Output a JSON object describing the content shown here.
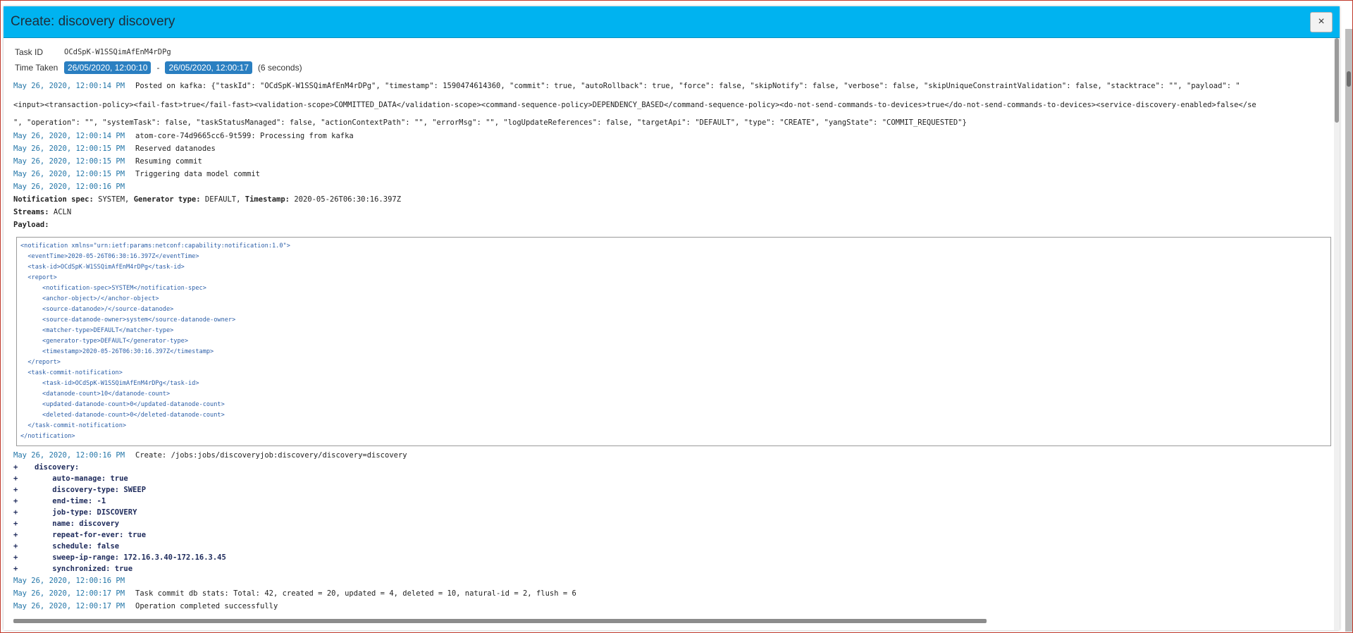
{
  "modal": {
    "title": "Create: discovery discovery",
    "close_label": "×"
  },
  "task": {
    "id_label": "Task ID",
    "id_value": "OCdSpK-W1SSQimAfEnM4rDPg",
    "time_label": "Time Taken",
    "start": "26/05/2020, 12:00:10",
    "separator": "-",
    "end": "26/05/2020, 12:00:17",
    "duration": "(6 seconds)"
  },
  "log": {
    "kafka_ts": "May 26, 2020, 12:00:14 PM",
    "kafka_msg_1": "Posted on kafka: {\"taskId\": \"OCdSpK-W1SSQimAfEnM4rDPg\", \"timestamp\": 1590474614360, \"commit\": true, \"autoRollback\": true, \"force\": false, \"skipNotify\": false, \"verbose\": false, \"skipUniqueConstraintValidation\": false, \"stacktrace\": \"\", \"payload\": \"",
    "kafka_msg_2": "<input><transaction-policy><fail-fast>true</fail-fast><validation-scope>COMMITTED_DATA</validation-scope><command-sequence-policy>DEPENDENCY_BASED</command-sequence-policy><do-not-send-commands-to-devices>true</do-not-send-commands-to-devices><service-discovery-enabled>false</se",
    "kafka_msg_3": "\", \"operation\": \"\", \"systemTask\": false, \"taskStatusManaged\": false, \"actionContextPath\": \"\", \"errorMsg\": \"\", \"logUpdateReferences\": false, \"targetApi\": \"DEFAULT\", \"type\": \"CREATE\", \"yangState\": \"COMMIT_REQUESTED\"}",
    "entries_a": [
      {
        "ts": "May 26, 2020, 12:00:14 PM",
        "msg": "atom-core-74d9665cc6-9t599: Processing from kafka"
      },
      {
        "ts": "May 26, 2020, 12:00:15 PM",
        "msg": "Reserved datanodes"
      },
      {
        "ts": "May 26, 2020, 12:00:15 PM",
        "msg": "Resuming commit"
      },
      {
        "ts": "May 26, 2020, 12:00:15 PM",
        "msg": "Triggering data model commit"
      },
      {
        "ts": "May 26, 2020, 12:00:16 PM",
        "msg": ""
      }
    ],
    "notification": {
      "spec_key": "Notification spec:",
      "spec_val": "SYSTEM,",
      "gen_key": "Generator type:",
      "gen_val": "DEFAULT,",
      "ts_key": "Timestamp:",
      "ts_val": "2020-05-26T06:30:16.397Z",
      "streams_key": "Streams:",
      "streams_val": "ACLN",
      "payload_key": "Payload:"
    },
    "payload_lines": [
      "<notification xmlns=\"urn:ietf:params:netconf:capability:notification:1.0\">",
      "  <eventTime>2020-05-26T06:30:16.397Z</eventTime>",
      "  <task-id>OCdSpK-W1SSQimAfEnM4rDPg</task-id>",
      "  <report>",
      "      <notification-spec>SYSTEM</notification-spec>",
      "      <anchor-object>/</anchor-object>",
      "      <source-datanode>/</source-datanode>",
      "      <source-datanode-owner>system</source-datanode-owner>",
      "      <matcher-type>DEFAULT</matcher-type>",
      "      <generator-type>DEFAULT</generator-type>",
      "      <timestamp>2020-05-26T06:30:16.397Z</timestamp>",
      "  </report>",
      "  <task-commit-notification>",
      "      <task-id>OCdSpK-W1SSQimAfEnM4rDPg</task-id>",
      "      <datanode-count>10</datanode-count>",
      "      <updated-datanode-count>0</updated-datanode-count>",
      "      <deleted-datanode-count>0</deleted-datanode-count>",
      "  </task-commit-notification>",
      "</notification>"
    ],
    "create_ts": "May 26, 2020, 12:00:16 PM",
    "create_msg": "Create: /jobs:jobs/discoveryjob:discovery/discovery=discovery",
    "diff": [
      {
        "plus": "+",
        "text": "discovery:"
      },
      {
        "plus": "+",
        "text": "    auto-manage: true"
      },
      {
        "plus": "+",
        "text": "    discovery-type: SWEEP"
      },
      {
        "plus": "+",
        "text": "    end-time: -1"
      },
      {
        "plus": "+",
        "text": "    job-type: DISCOVERY"
      },
      {
        "plus": "+",
        "text": "    name: discovery"
      },
      {
        "plus": "+",
        "text": "    repeat-for-ever: true"
      },
      {
        "plus": "+",
        "text": "    schedule: false"
      },
      {
        "plus": "+",
        "text": "    sweep-ip-range: 172.16.3.40-172.16.3.45"
      },
      {
        "plus": "+",
        "text": "    synchronized: true"
      }
    ],
    "entries_b": [
      {
        "ts": "May 26, 2020, 12:00:16 PM",
        "msg": ""
      },
      {
        "ts": "May 26, 2020, 12:00:17 PM",
        "msg": "Task commit db stats: Total: 42, created = 20, updated = 4, deleted = 10, natural-id = 2, flush = 6"
      },
      {
        "ts": "May 26, 2020, 12:00:17 PM",
        "msg": "Operation completed successfully"
      }
    ]
  }
}
